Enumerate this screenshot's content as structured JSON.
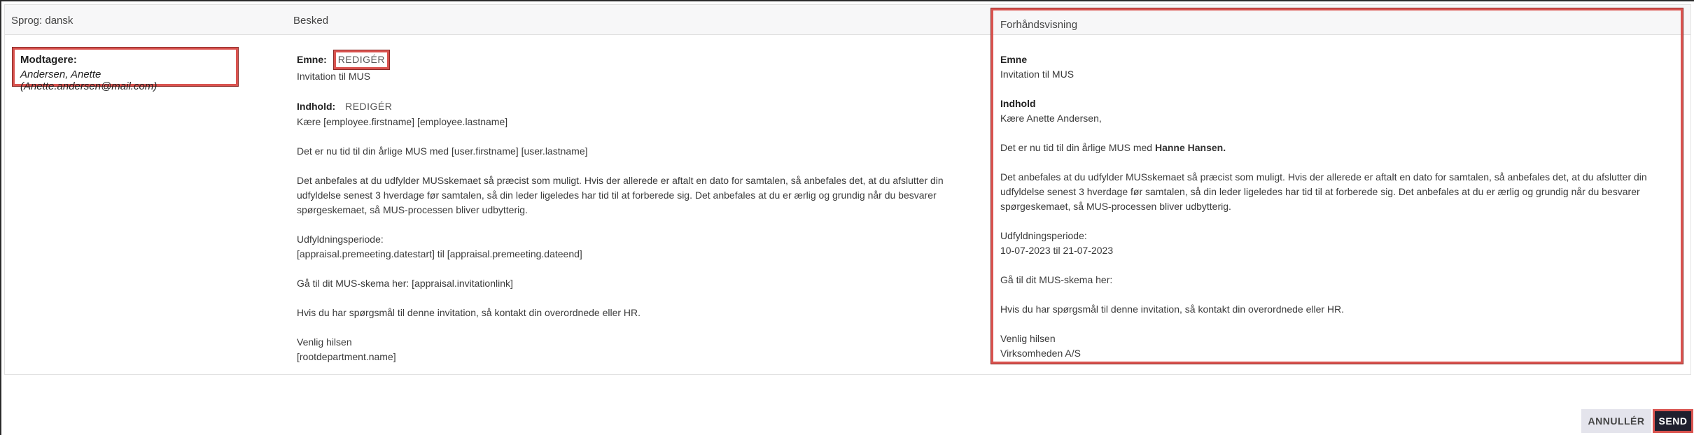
{
  "header": {
    "language": "Sprog: dansk",
    "message": "Besked",
    "preview": "Forhåndsvisning"
  },
  "recipients": {
    "label": "Modtagere:",
    "value": "Andersen, Anette (Anette.andersen@mail.com)"
  },
  "message": {
    "subject_label": "Emne:",
    "subject_edit": "REDIGÉR",
    "subject_value": "Invitation til MUS",
    "content_label": "Indhold:",
    "content_edit": "REDIGÉR",
    "line1": "Kære [employee.firstname] [employee.lastname]",
    "line2": "Det er nu tid til din årlige MUS med [user.firstname] [user.lastname]",
    "para1_a": "Det anbefales at du udfylder MUSskemaet så præcist som muligt. Hvis der allerede er aftalt en dato for samtalen, så anbefales det, at du afslutter din",
    "para1_b": "udfyldelse senest 3 hverdage før samtalen, så din leder ligeledes har tid til at forberede sig. Det anbefales at du er ærlig og grundig når du besvarer",
    "para1_c": "spørgeskemaet, så MUS-processen bliver udbytterig.",
    "period_label": "Udfyldningsperiode:",
    "period_value": "[appraisal.premeeting.datestart] til [appraisal.premeeting.dateend]",
    "link_line": "Gå til dit MUS-skema her: [appraisal.invitationlink]",
    "questions": "Hvis du har spørgsmål til denne invitation, så kontakt din overordnede eller HR.",
    "regards": "Venlig hilsen",
    "signature": "[rootdepartment.name]"
  },
  "preview": {
    "subject_label": "Emne",
    "subject_value": "Invitation til MUS",
    "content_label": "Indhold",
    "greeting_prefix": "Kære ",
    "greeting_name": "Anette Andersen",
    "greeting_suffix": ",",
    "line2_prefix": "Det er nu tid til din årlige MUS med ",
    "line2_name": "Hanne Hansen.",
    "para1_a": "Det anbefales at du udfylder MUSskemaet så præcist som muligt. Hvis der allerede er aftalt en dato for samtalen, så anbefales det, at du afslutter din",
    "para1_b": "udfyldelse senest 3 hverdage før samtalen, så din leder ligeledes har tid til at forberede sig. Det anbefales at du er ærlig og grundig når du besvarer",
    "para1_c": "spørgeskemaet, så MUS-processen bliver udbytterig.",
    "period_label": "Udfyldningsperiode:",
    "period_value": "10-07-2023 til 21-07-2023",
    "link_line": "Gå til dit MUS-skema her:",
    "questions": "Hvis du har spørgsmål til denne invitation, så kontakt din overordnede eller HR.",
    "regards": "Venlig hilsen",
    "signature": "Virksomheden A/S"
  },
  "buttons": {
    "cancel": "ANNULLÉR",
    "send": "SEND"
  },
  "colors": {
    "highlight": "#d9534f",
    "send_bg": "#1f1f2e",
    "cancel_bg": "#e4e4ec"
  }
}
